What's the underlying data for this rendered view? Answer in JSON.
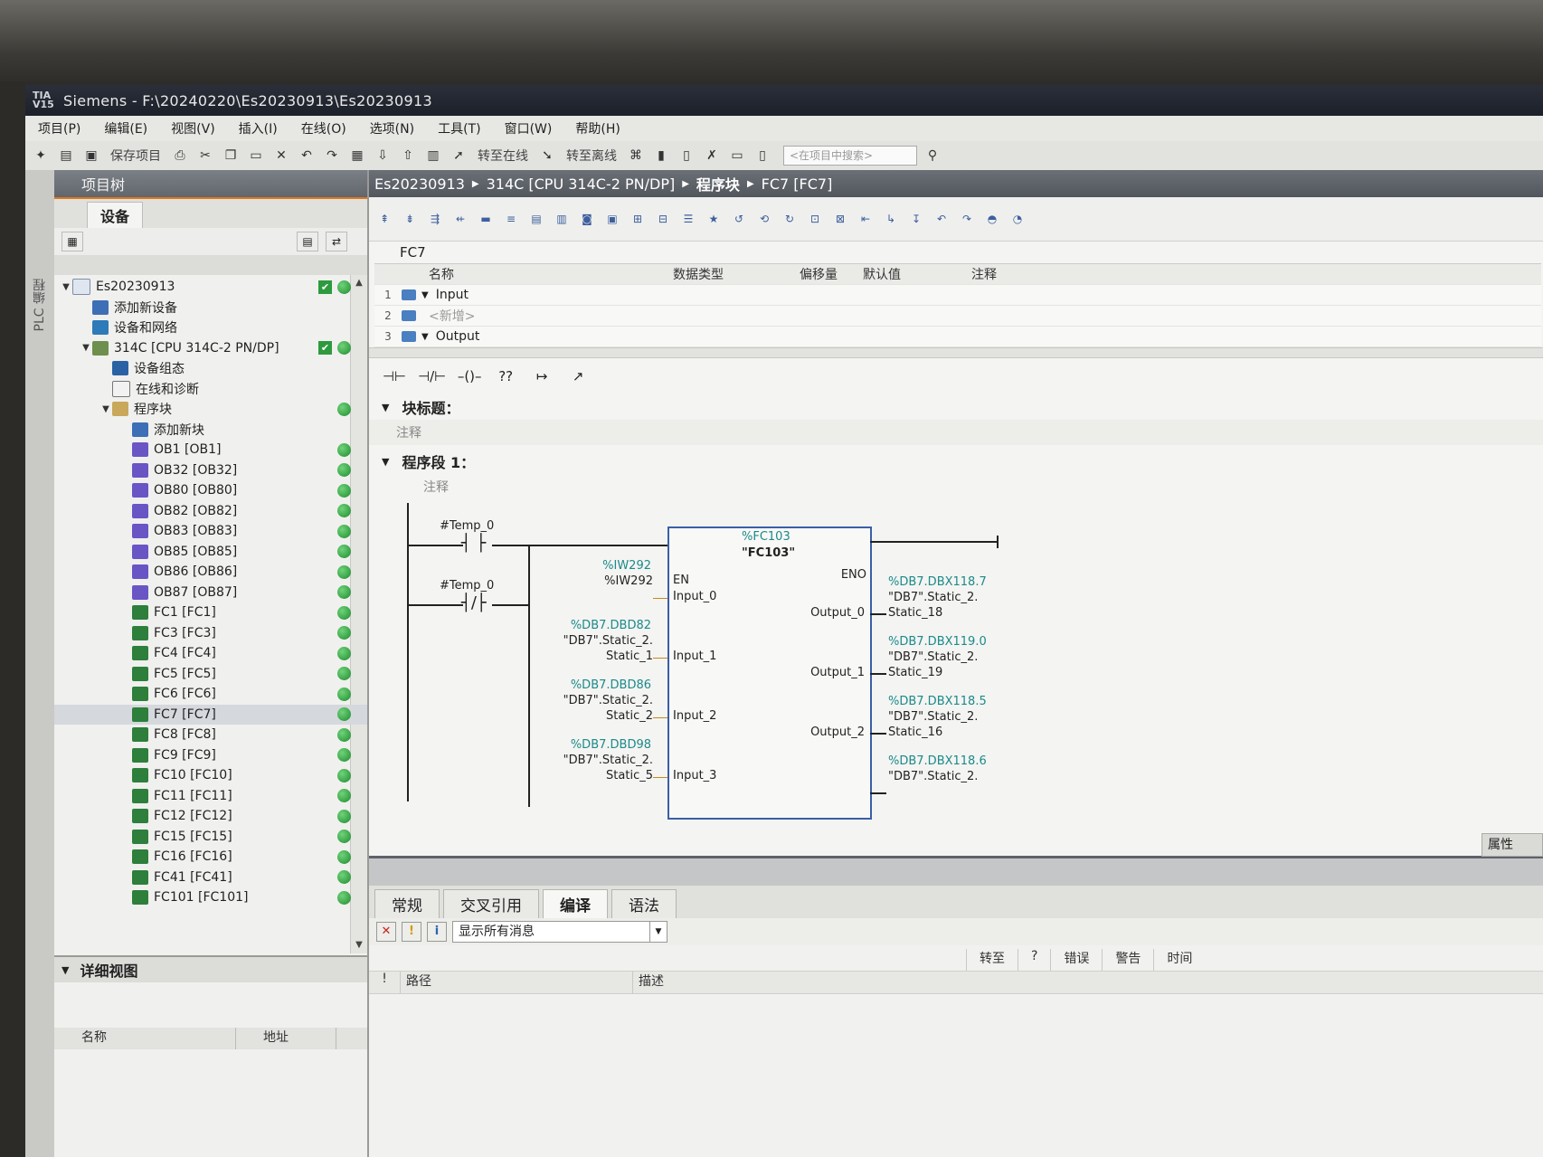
{
  "window": {
    "title": "Siemens  -  F:\\20240220\\Es20230913\\Es20230913",
    "logo": "TIA V15"
  },
  "menu": [
    "项目(P)",
    "编辑(E)",
    "视图(V)",
    "插入(I)",
    "在线(O)",
    "选项(N)",
    "工具(T)",
    "窗口(W)",
    "帮助(H)"
  ],
  "toolbar": {
    "save_label": "保存项目",
    "go_online": "转至在线",
    "go_offline": "转至离线",
    "search_placeholder": "<在项目中搜索>"
  },
  "side_strip_label": "PLC 编程",
  "project_tree": {
    "header": "项目树",
    "tab": "设备",
    "items": [
      {
        "label": "Es20230913",
        "level": 0,
        "expander": "▼",
        "icon": "project-icon",
        "check": true,
        "dot": true
      },
      {
        "label": "添加新设备",
        "level": 1,
        "expander": "",
        "icon": "add-device-icon"
      },
      {
        "label": "设备和网络",
        "level": 1,
        "expander": "",
        "icon": "network-icon"
      },
      {
        "label": "314C [CPU 314C-2 PN/DP]",
        "level": 1,
        "expander": "▼",
        "icon": "cpu-icon",
        "check": true,
        "dot": true
      },
      {
        "label": "设备组态",
        "level": 2,
        "expander": "",
        "icon": "device-config-icon"
      },
      {
        "label": "在线和诊断",
        "level": 2,
        "expander": "",
        "icon": "diagnostics-icon"
      },
      {
        "label": "程序块",
        "level": 2,
        "expander": "▼",
        "icon": "folder-icon",
        "dot": true
      },
      {
        "label": "添加新块",
        "level": 3,
        "expander": "",
        "icon": "add-block-icon"
      },
      {
        "label": "OB1 [OB1]",
        "level": 3,
        "expander": "",
        "icon": "ob-icon",
        "dot": true
      },
      {
        "label": "OB32 [OB32]",
        "level": 3,
        "expander": "",
        "icon": "ob-icon",
        "dot": true
      },
      {
        "label": "OB80 [OB80]",
        "level": 3,
        "expander": "",
        "icon": "ob-icon",
        "dot": true
      },
      {
        "label": "OB82 [OB82]",
        "level": 3,
        "expander": "",
        "icon": "ob-icon",
        "dot": true
      },
      {
        "label": "OB83 [OB83]",
        "level": 3,
        "expander": "",
        "icon": "ob-icon",
        "dot": true
      },
      {
        "label": "OB85 [OB85]",
        "level": 3,
        "expander": "",
        "icon": "ob-icon",
        "dot": true
      },
      {
        "label": "OB86 [OB86]",
        "level": 3,
        "expander": "",
        "icon": "ob-icon",
        "dot": true
      },
      {
        "label": "OB87 [OB87]",
        "level": 3,
        "expander": "",
        "icon": "ob-icon",
        "dot": true
      },
      {
        "label": "FC1 [FC1]",
        "level": 3,
        "expander": "",
        "icon": "fc-icon",
        "dot": true
      },
      {
        "label": "FC3 [FC3]",
        "level": 3,
        "expander": "",
        "icon": "fc-icon",
        "dot": true
      },
      {
        "label": "FC4 [FC4]",
        "level": 3,
        "expander": "",
        "icon": "fc-icon",
        "dot": true
      },
      {
        "label": "FC5 [FC5]",
        "level": 3,
        "expander": "",
        "icon": "fc-icon",
        "dot": true
      },
      {
        "label": "FC6 [FC6]",
        "level": 3,
        "expander": "",
        "icon": "fc-icon",
        "dot": true
      },
      {
        "label": "FC7 [FC7]",
        "level": 3,
        "expander": "",
        "icon": "fc-icon",
        "dot": true,
        "selected": true
      },
      {
        "label": "FC8 [FC8]",
        "level": 3,
        "expander": "",
        "icon": "fc-icon",
        "dot": true
      },
      {
        "label": "FC9 [FC9]",
        "level": 3,
        "expander": "",
        "icon": "fc-icon",
        "dot": true
      },
      {
        "label": "FC10 [FC10]",
        "level": 3,
        "expander": "",
        "icon": "fc-icon",
        "dot": true
      },
      {
        "label": "FC11 [FC11]",
        "level": 3,
        "expander": "",
        "icon": "fc-icon",
        "dot": true
      },
      {
        "label": "FC12 [FC12]",
        "level": 3,
        "expander": "",
        "icon": "fc-icon",
        "dot": true
      },
      {
        "label": "FC15 [FC15]",
        "level": 3,
        "expander": "",
        "icon": "fc-icon",
        "dot": true
      },
      {
        "label": "FC16 [FC16]",
        "level": 3,
        "expander": "",
        "icon": "fc-icon",
        "dot": true
      },
      {
        "label": "FC41 [FC41]",
        "level": 3,
        "expander": "",
        "icon": "fc-icon",
        "dot": true
      },
      {
        "label": "FC101 [FC101]",
        "level": 3,
        "expander": "",
        "icon": "fc-icon",
        "dot": true
      }
    ]
  },
  "detail_view": {
    "title": "详细视图",
    "col_name": "名称",
    "col_address": "地址"
  },
  "breadcrumb": [
    "Es20230913",
    "314C [CPU 314C-2 PN/DP]",
    "程序块",
    "FC7 [FC7]"
  ],
  "editor": {
    "block_name": "FC7",
    "interface_headers": {
      "name": "名称",
      "type": "数据类型",
      "offset": "偏移量",
      "default": "默认值",
      "comment": "注释"
    },
    "interface_rows": [
      {
        "num": "1",
        "name": "Input",
        "expander": "▼"
      },
      {
        "num": "2",
        "name": "<新增>",
        "expander": ""
      },
      {
        "num": "3",
        "name": "Output",
        "expander": "▼"
      }
    ],
    "ladder_tools": [
      "⊣⊢",
      "⊣/⊢",
      "–()–",
      "??",
      "↦",
      "↗"
    ],
    "block_title": "块标题：",
    "comment_label": "注释",
    "network_title": "程序段 1：",
    "network_comment": "注释"
  },
  "ladder": {
    "contact1_tag": "#Temp_0",
    "contact2_tag": "#Temp_0",
    "instance": "%FC103",
    "block": "\"FC103\"",
    "en": "EN",
    "eno": "ENO",
    "inputs": [
      {
        "pin": "Input_0",
        "addr": "%IW292",
        "sym1": "%IW292",
        "sym2": ""
      },
      {
        "pin": "Input_1",
        "addr": "%DB7.DBD82",
        "sym1": "\"DB7\".Static_2.",
        "sym2": "Static_1"
      },
      {
        "pin": "Input_2",
        "addr": "%DB7.DBD86",
        "sym1": "\"DB7\".Static_2.",
        "sym2": "Static_2"
      },
      {
        "pin": "Input_3",
        "addr": "%DB7.DBD98",
        "sym1": "\"DB7\".Static_2.",
        "sym2": "Static_5"
      }
    ],
    "outputs": [
      {
        "pin": "Output_0",
        "addr": "%DB7.DBX118.7",
        "sym1": "\"DB7\".Static_2.",
        "sym2": "Static_18"
      },
      {
        "pin": "Output_1",
        "addr": "%DB7.DBX119.0",
        "sym1": "\"DB7\".Static_2.",
        "sym2": "Static_19"
      },
      {
        "pin": "Output_2",
        "addr": "%DB7.DBX118.5",
        "sym1": "\"DB7\".Static_2.",
        "sym2": "Static_16"
      },
      {
        "pin": "",
        "addr": "%DB7.DBX118.6",
        "sym1": "\"DB7\".Static_2.",
        "sym2": ""
      }
    ]
  },
  "bottom": {
    "tabs": [
      "常规",
      "交叉引用",
      "编译",
      "语法"
    ],
    "active_tab": "编译",
    "filter": "显示所有消息",
    "col_path": "路径",
    "col_desc": "描述",
    "col_goto": "转至",
    "col_q": "?",
    "col_err": "错误",
    "col_warn": "警告",
    "col_time": "时间",
    "props_tab": "属性"
  },
  "colors": {
    "accent": "#e07a1a",
    "ok_green": "#2e9a3e",
    "fb_border": "#3a5fa8",
    "address_teal": "#1b8a8a"
  }
}
